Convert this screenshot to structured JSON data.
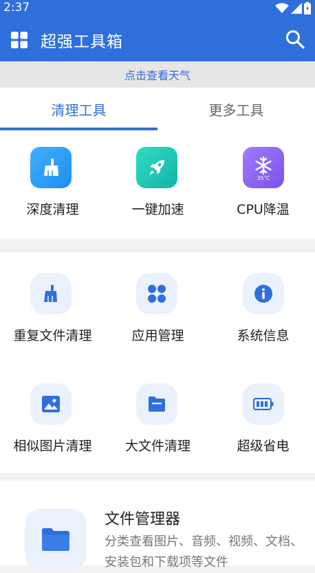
{
  "status_bar": {
    "time": "2:37"
  },
  "app_bar": {
    "title": "超强工具箱"
  },
  "weather_banner": "点击查看天气",
  "tabs": [
    {
      "label": "清理工具",
      "active": true
    },
    {
      "label": "更多工具",
      "active": false
    }
  ],
  "featured_tools": [
    {
      "label": "深度清理",
      "icon": "broom-icon",
      "color": "#2f9cf5"
    },
    {
      "label": "一键加速",
      "icon": "rocket-icon",
      "color": "#1fc8b4"
    },
    {
      "label": "CPU降温",
      "icon": "snowflake-icon",
      "color": "#8a63f0",
      "badge": "35℃"
    }
  ],
  "tools": [
    {
      "label": "重复文件清理",
      "icon": "broom-icon"
    },
    {
      "label": "应用管理",
      "icon": "apps-icon"
    },
    {
      "label": "系统信息",
      "icon": "info-icon"
    },
    {
      "label": "相似图片清理",
      "icon": "image-icon"
    },
    {
      "label": "大文件清理",
      "icon": "file-icon"
    },
    {
      "label": "超级省电",
      "icon": "battery-icon"
    }
  ],
  "file_manager": {
    "title": "文件管理器",
    "description": "分类查看图片、音频、视频、文档、安装包和下载项等文件",
    "icon": "folder-icon"
  },
  "colors": {
    "primary": "#2f6fdc",
    "icon_tint": "#2f6fdc",
    "soft_bg": "#ebf1fc"
  }
}
